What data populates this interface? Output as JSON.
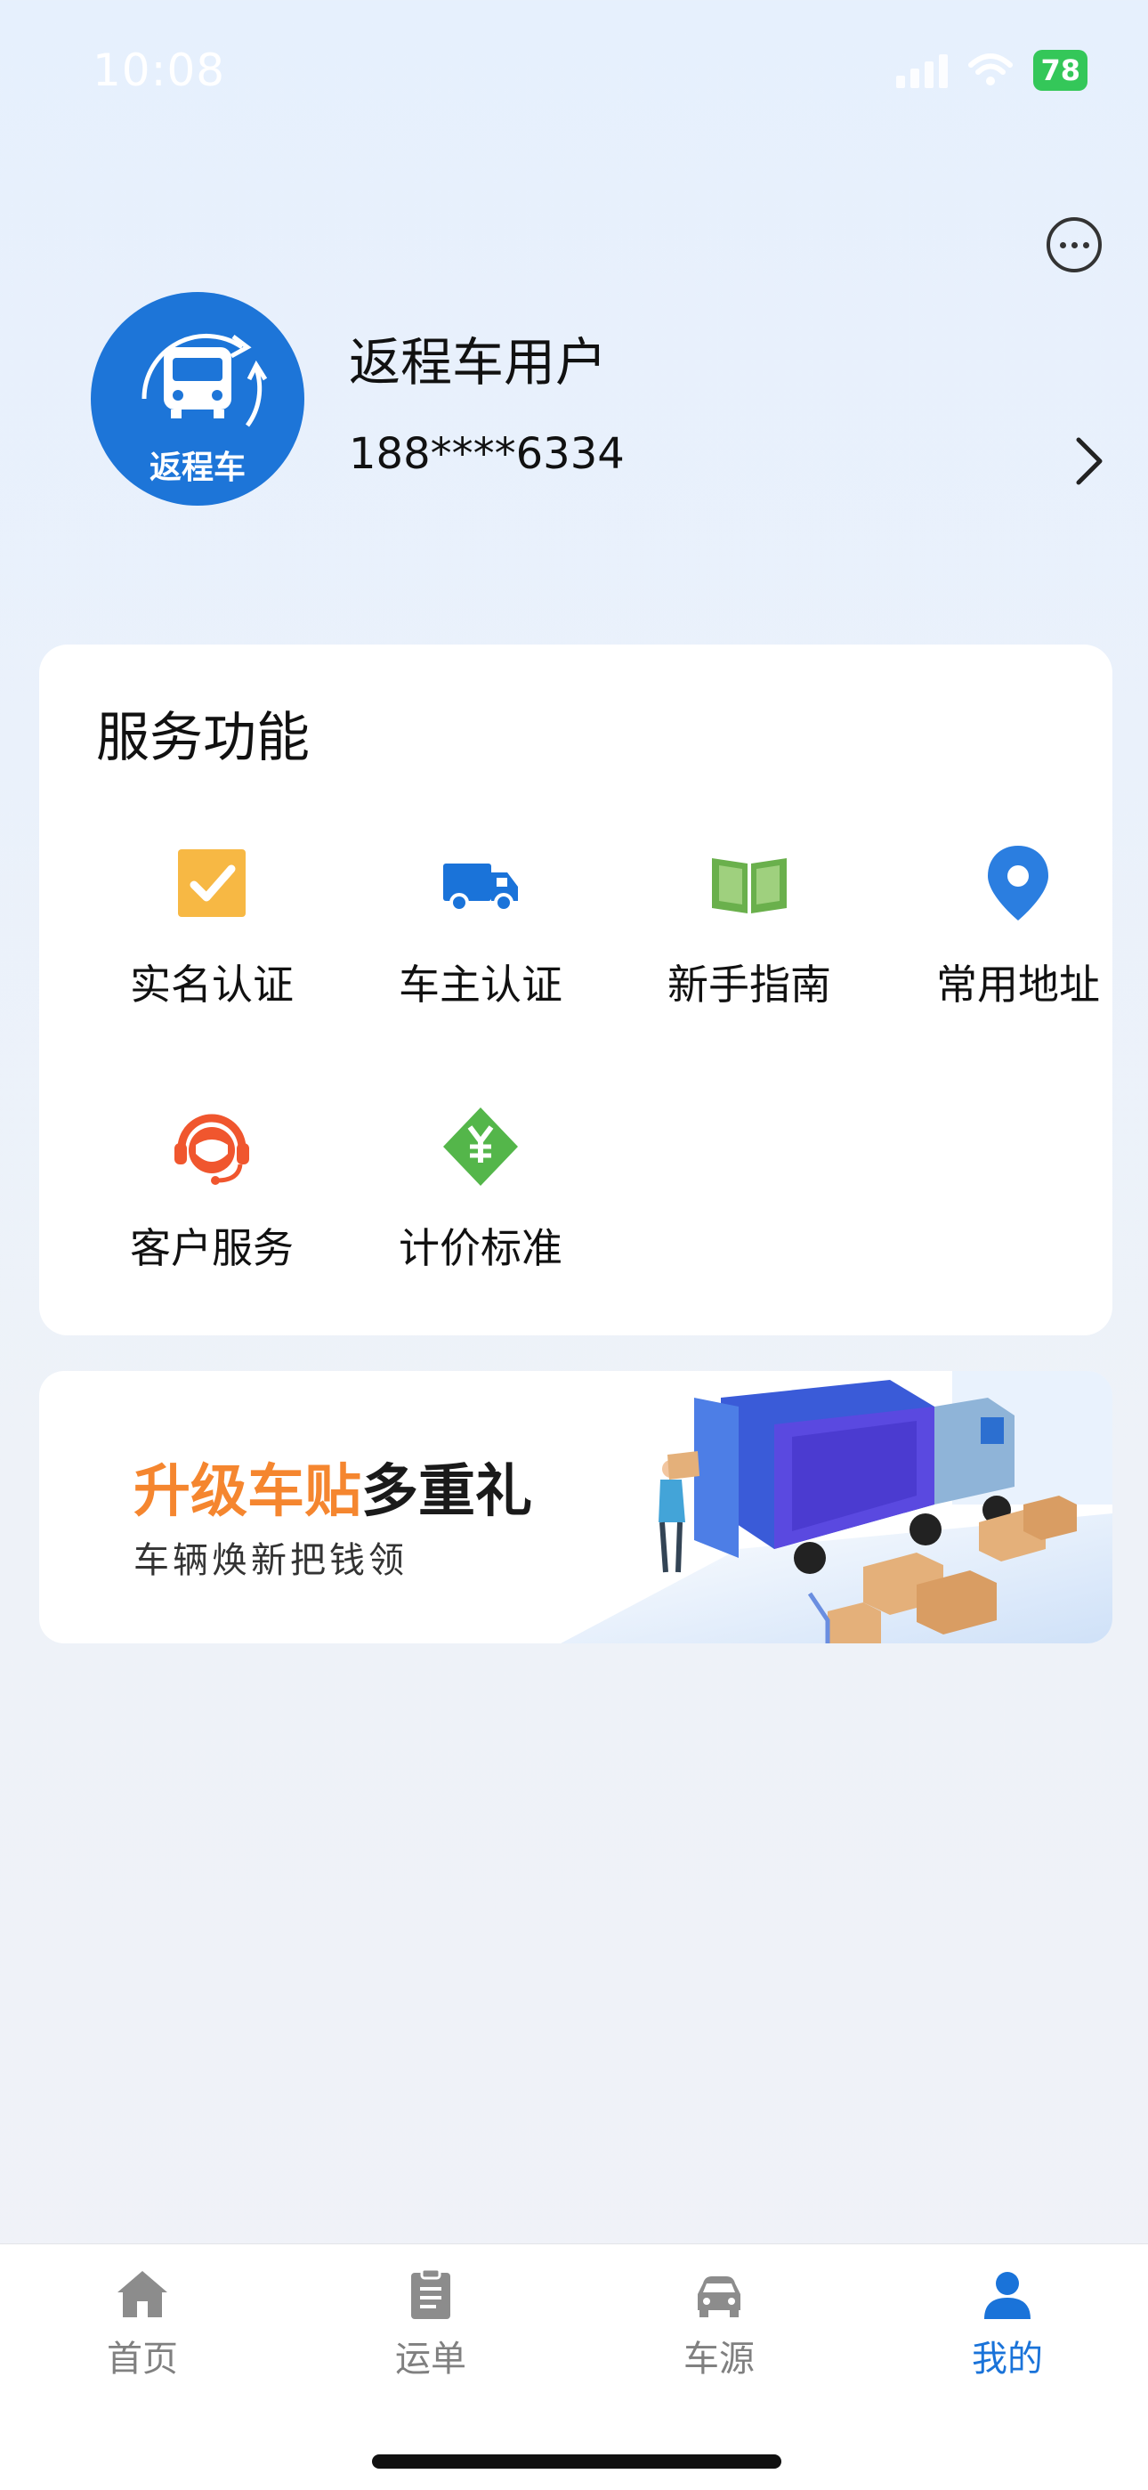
{
  "status_bar": {
    "time": "10:08",
    "battery": "78"
  },
  "header": {
    "avatar_text": "返程车",
    "user_name": "返程车用户",
    "phone": "188****6334"
  },
  "services": {
    "title": "服务功能",
    "items": [
      {
        "label": "实名认证",
        "icon": "checkbox-icon",
        "color": "#f7b844"
      },
      {
        "label": "车主认证",
        "icon": "truck-icon",
        "color": "#1a73d9"
      },
      {
        "label": "新手指南",
        "icon": "book-icon",
        "color": "#6ab04c"
      },
      {
        "label": "常用地址",
        "icon": "location-pin-icon",
        "color": "#2b7ee0"
      },
      {
        "label": "客户服务",
        "icon": "headset-icon",
        "color": "#f0562e"
      },
      {
        "label": "计价标准",
        "icon": "price-tag-icon",
        "color": "#54b64a"
      }
    ]
  },
  "banner": {
    "title_highlight": "升级车贴",
    "title_rest": "多重礼",
    "subtitle": "车辆焕新把钱领"
  },
  "tab_bar": {
    "tabs": [
      {
        "label": "首页",
        "icon": "home-icon"
      },
      {
        "label": "运单",
        "icon": "clipboard-icon"
      },
      {
        "label": "车源",
        "icon": "car-icon"
      },
      {
        "label": "我的",
        "icon": "user-icon",
        "active": true
      }
    ],
    "active_color": "#1a73d9",
    "inactive_color": "#808080"
  }
}
